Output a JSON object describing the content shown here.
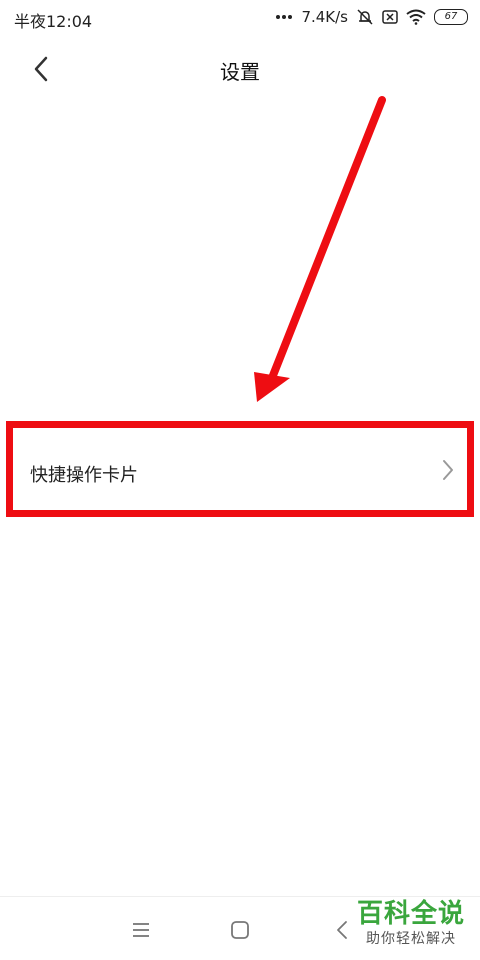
{
  "status_bar": {
    "time": "半夜12:04",
    "network_speed": "7.4K/s",
    "battery_level": "67",
    "icons": [
      "more-dots-icon",
      "mute-icon",
      "sim-icon",
      "wifi-icon",
      "battery-icon"
    ]
  },
  "header": {
    "title": "设置",
    "back_icon": "chevron-left-icon"
  },
  "settings": {
    "items": [
      {
        "label": "快捷操作卡片",
        "icon": "chevron-right-icon",
        "highlighted": true
      }
    ]
  },
  "annotation": {
    "color": "#ee0d12",
    "arrow": "red-arrow-pointing-to-item"
  },
  "nav_bar": {
    "icons": [
      "menu-icon",
      "home-icon",
      "back-icon"
    ]
  },
  "watermark": {
    "main": "百科全说",
    "sub": "助你轻松解决",
    "color": "#3aa63d"
  }
}
